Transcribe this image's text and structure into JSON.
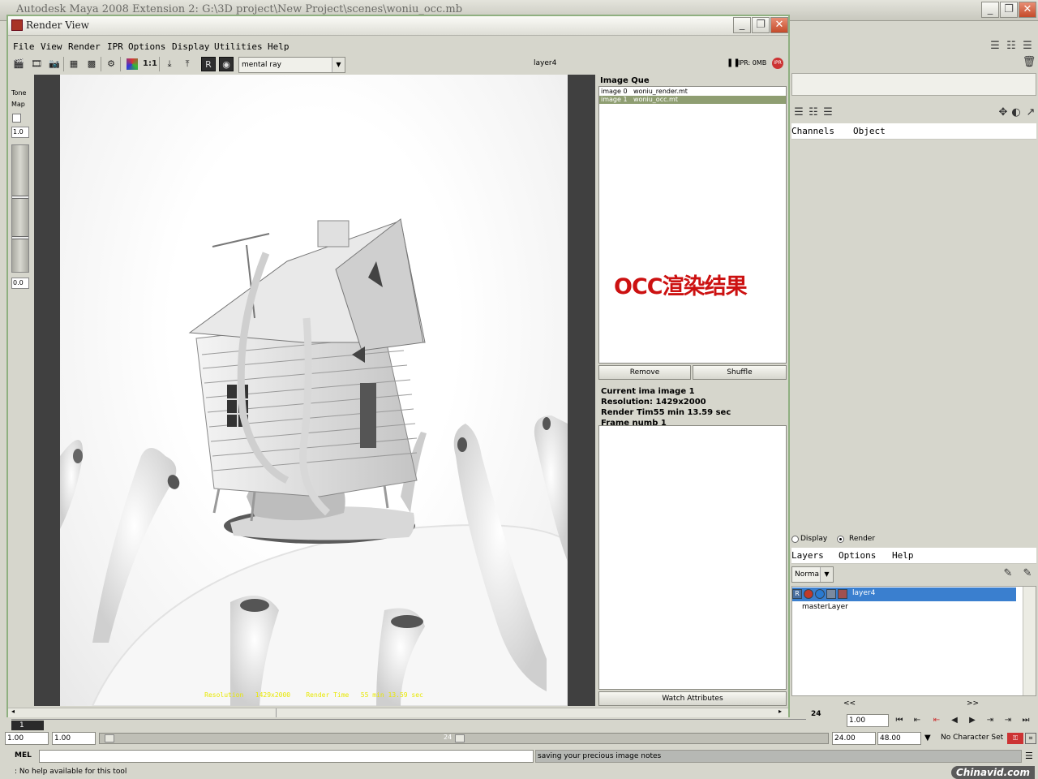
{
  "maya": {
    "title": "Autodesk Maya 2008 Extension 2: G:\\3D project\\New Project\\scenes\\woniu_occ.mb",
    "channels_menu": [
      "Channels",
      "Object"
    ],
    "layer_editor": {
      "display_label": "Display",
      "render_label": "Render",
      "selected_mode": "Render",
      "menu": [
        "Layers",
        "Options",
        "Help"
      ],
      "blend_mode": "Normal",
      "layers": [
        {
          "name": "layer4",
          "selected": true
        },
        {
          "name": "masterLayer",
          "selected": false
        }
      ],
      "icon_r": "R",
      "page_prev": "<<",
      "page_next": ">>"
    }
  },
  "render_view": {
    "title": "Render View",
    "menu": [
      "File",
      "View",
      "Render",
      "IPR",
      "Options",
      "Display",
      "Utilities",
      "Help"
    ],
    "renderer": "mental ray",
    "layer_label": "layer4",
    "ipr_status": "IPR: 0MB",
    "ratio_label": "1:1",
    "tone_map_label_1": "Tone",
    "tone_map_label_2": "Map",
    "tone_max": "1.0",
    "tone_min": "0.0",
    "render_caption": "Resolution   1429x2000    Render Time   55 min 13.59 sec",
    "image_queue": {
      "title": "Image Que",
      "items": [
        {
          "id": "image 0",
          "name": "woniu_render.mt",
          "selected": false
        },
        {
          "id": "image 1",
          "name": "woniu_occ.mt",
          "selected": true
        }
      ],
      "overlay_text": "OCC渲染结果",
      "remove_label": "Remove",
      "shuffle_label": "Shuffle"
    },
    "info": {
      "current": "Current ima image 1",
      "resolution": "Resolution: 1429x2000",
      "render_time": "Render Tim55 min 13.59 sec",
      "frame": "Frame numb 1"
    },
    "watch_label": "Watch Attributes"
  },
  "timeline": {
    "current_frame": "1",
    "end_marker": "24",
    "current_time": "1.00",
    "range_start": "1.00",
    "range_inner_start": "1.00",
    "range_inner_end": "24",
    "range_end": "24.00",
    "anim_end": "48.00",
    "character_set": "No Character Set"
  },
  "command_line": {
    "label": "MEL",
    "output": "saving your precious image notes"
  },
  "help_line": ": No help available for this tool",
  "watermark": "Chinavid.com",
  "colors": {
    "window_frame": "#8fb080",
    "selected_queue_row": "#8f9e72",
    "selected_layer": "#3a7fcf",
    "overlay_red": "#cc1111",
    "caption_yellow": "#e8e800"
  }
}
